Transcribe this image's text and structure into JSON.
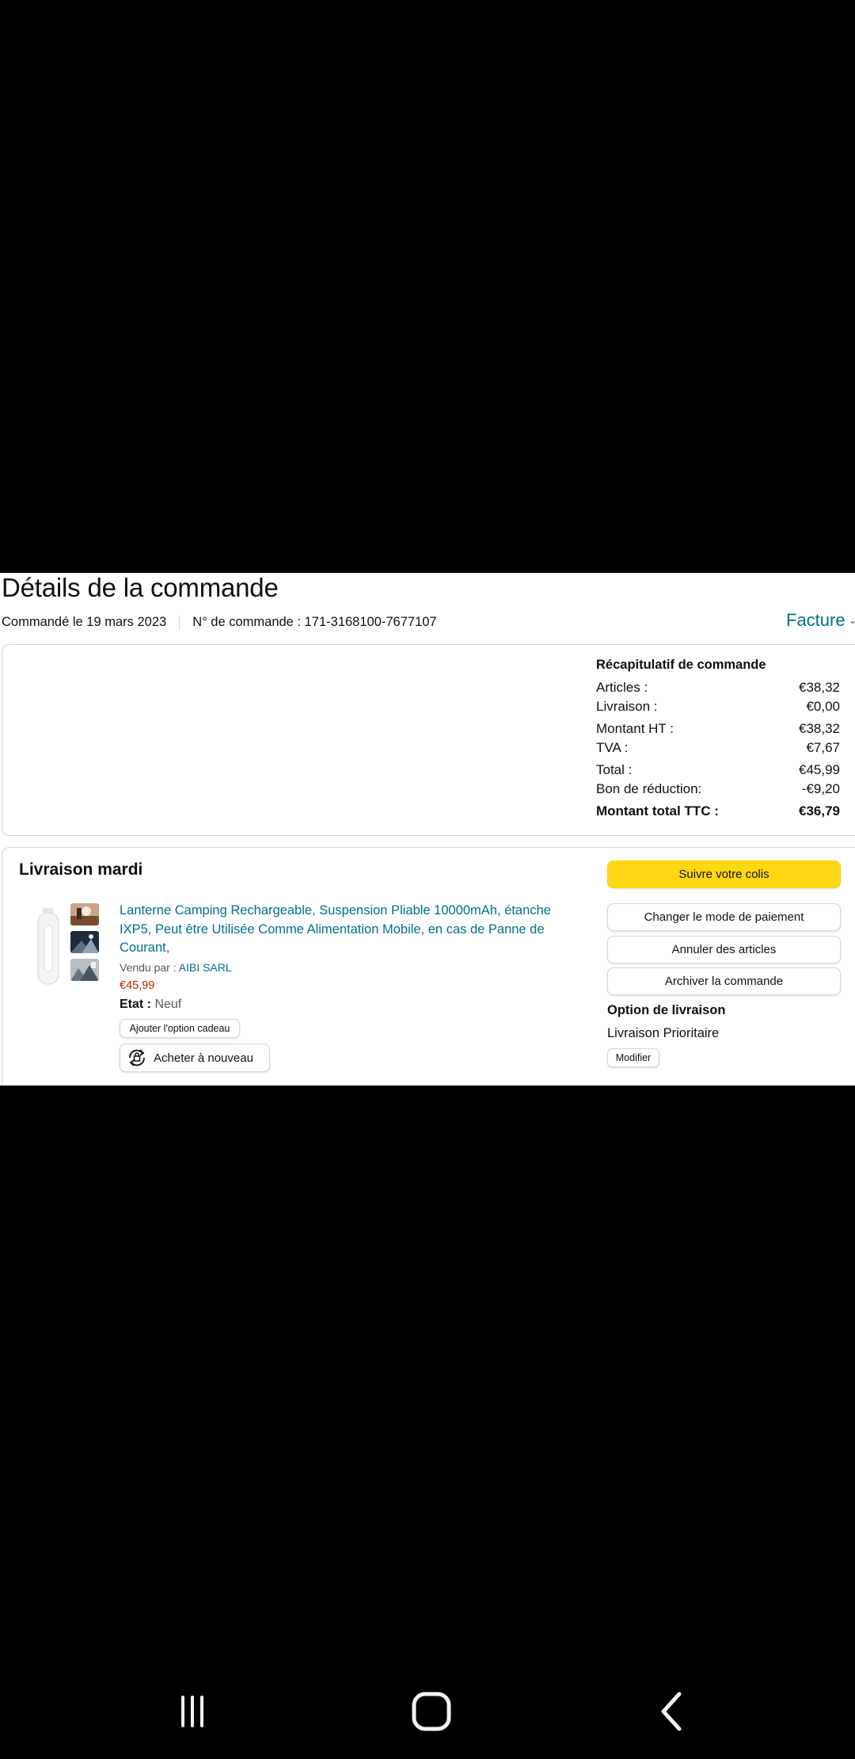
{
  "page": {
    "title": "Détails de la commande",
    "ordered_on": "Commandé le 19 mars 2023",
    "order_number": "N° de commande : 171-3168100-7677107",
    "invoice_label": "Facture"
  },
  "summary": {
    "heading": "Récapitulatif de commande",
    "rows": [
      {
        "label": "Articles :",
        "value": "€38,32"
      },
      {
        "label": "Livraison :",
        "value": "€0,00"
      },
      {
        "label": "Montant HT :",
        "value": "€38,32"
      },
      {
        "label": "TVA :",
        "value": "€7,67"
      },
      {
        "label": "Total :",
        "value": "€45,99"
      },
      {
        "label": "Bon de réduction:",
        "value": "-€9,20"
      },
      {
        "label": "Montant total TTC :",
        "value": "€36,79"
      }
    ]
  },
  "delivery": {
    "title": "Livraison mardi",
    "product": {
      "title": "Lanterne Camping Rechargeable, Suspension Pliable 10000mAh, étanche IXP5, Peut être Utilisée Comme Alimentation Mobile, en cas de Panne de Courant,",
      "sold_by_label": "Vendu par :",
      "seller": "AIBI SARL",
      "price": "€45,99",
      "condition_label": "Etat :",
      "condition_value": "Neuf",
      "gift_button": "Ajouter l'option cadeau",
      "buy_again_button": "Acheter à nouveau"
    },
    "actions": {
      "track": "Suivre votre colis",
      "change_payment": "Changer le mode de paiement",
      "cancel_items": "Annuler des articles",
      "archive": "Archiver la commande"
    },
    "option": {
      "title": "Option de livraison",
      "value": "Livraison Prioritaire",
      "modify": "Modifier"
    }
  },
  "navbar": {
    "icons": [
      "recent-apps-icon",
      "home-icon",
      "back-icon"
    ]
  },
  "colors": {
    "link": "#007185",
    "price": "#b12704",
    "primary_button": "#ffd814",
    "text": "#0f1111"
  }
}
